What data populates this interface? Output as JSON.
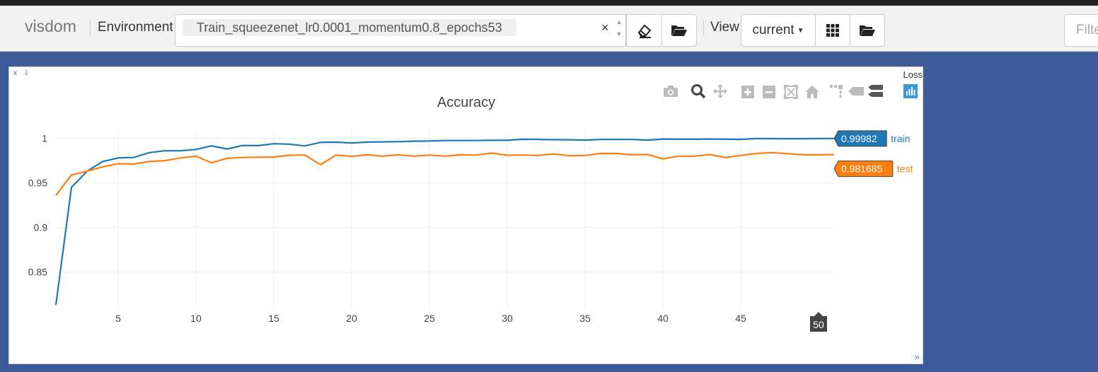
{
  "app": {
    "brand": "visdom"
  },
  "environment": {
    "label": "Environment",
    "selected": "Train_squeezenet_lr0.0001_momentum0.8_epochs53",
    "clear_glyph": "×"
  },
  "view": {
    "label": "View",
    "selected": "current"
  },
  "filter": {
    "placeholder": "Filte"
  },
  "icons": {
    "eraser": "eraser-icon",
    "folder": "folder-open-icon",
    "grid": "grid-icon",
    "folder2": "folder-open-icon"
  },
  "pane": {
    "title": "Loss",
    "close_glyph": "x",
    "pin_glyph": "⇩",
    "resize_glyph": "»"
  },
  "colors": {
    "train": "#1f77b4",
    "test": "#ff7f0e",
    "modebar_active": "#3a9ad9"
  },
  "chart_data": {
    "type": "line",
    "title": "Accuracy",
    "xlabel": "",
    "ylabel": "",
    "xlim": [
      1,
      51
    ],
    "ylim": [
      0.81,
      1.01
    ],
    "xticks": [
      5,
      10,
      15,
      20,
      25,
      30,
      35,
      40,
      45
    ],
    "yticks": [
      0.85,
      0.9,
      0.95,
      1
    ],
    "ytick_labels": [
      "0.85",
      "0.9",
      "0.95",
      "1"
    ],
    "grid": true,
    "x": [
      1,
      2,
      3,
      4,
      5,
      6,
      7,
      8,
      9,
      10,
      11,
      12,
      13,
      14,
      15,
      16,
      17,
      18,
      19,
      20,
      21,
      22,
      23,
      24,
      25,
      26,
      27,
      28,
      29,
      30,
      31,
      32,
      33,
      34,
      35,
      36,
      37,
      38,
      39,
      40,
      41,
      42,
      43,
      44,
      45,
      46,
      47,
      48,
      49,
      50,
      51
    ],
    "series": [
      {
        "name": "train",
        "values": [
          0.813,
          0.945,
          0.963,
          0.974,
          0.978,
          0.9785,
          0.984,
          0.986,
          0.986,
          0.9875,
          0.9915,
          0.988,
          0.992,
          0.9918,
          0.994,
          0.9935,
          0.9915,
          0.9955,
          0.9957,
          0.9948,
          0.9958,
          0.996,
          0.9963,
          0.9968,
          0.997,
          0.9975,
          0.9975,
          0.9975,
          0.9978,
          0.9978,
          0.999,
          0.9987,
          0.9985,
          0.9983,
          0.998,
          0.9987,
          0.9987,
          0.9987,
          0.998,
          0.9992,
          0.999,
          0.999,
          0.9992,
          0.999,
          0.9988,
          0.9998,
          0.9997,
          0.9996,
          0.9996,
          0.9998,
          0.99982
        ]
      },
      {
        "name": "test",
        "values": [
          0.936,
          0.959,
          0.963,
          0.968,
          0.9715,
          0.9712,
          0.974,
          0.975,
          0.978,
          0.98,
          0.9725,
          0.9775,
          0.9785,
          0.9788,
          0.979,
          0.981,
          0.9812,
          0.9705,
          0.9812,
          0.9798,
          0.9815,
          0.98,
          0.9815,
          0.98,
          0.9812,
          0.98,
          0.9815,
          0.9812,
          0.9835,
          0.981,
          0.9812,
          0.9808,
          0.9825,
          0.9805,
          0.9808,
          0.983,
          0.983,
          0.9815,
          0.982,
          0.977,
          0.98,
          0.98,
          0.9818,
          0.9785,
          0.9808,
          0.983,
          0.984,
          0.9828,
          0.9815,
          0.9815,
          0.981685
        ]
      }
    ],
    "hover": {
      "x_label": "50",
      "train_value": "0.99982",
      "test_value": "0.981685"
    }
  }
}
